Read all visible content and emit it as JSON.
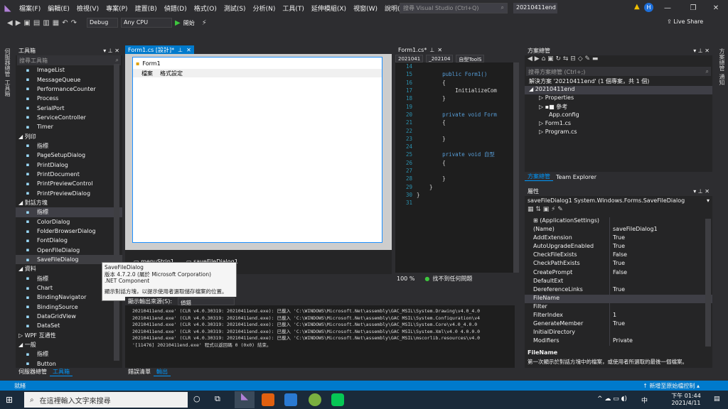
{
  "menu": {
    "items": [
      "檔案(F)",
      "編輯(E)",
      "檢視(V)",
      "專案(P)",
      "建置(B)",
      "偵錯(D)",
      "格式(O)",
      "測試(S)",
      "分析(N)",
      "工具(T)",
      "延伸模組(X)",
      "視窗(W)",
      "說明(H)"
    ],
    "search_placeholder": "搜尋 Visual Studio (Ctrl+Q)",
    "project_name": "20210411end",
    "avatar": "H"
  },
  "toolbar": {
    "config": "Debug",
    "platform": "Any CPU",
    "start": "開始",
    "live_share": "Live Share"
  },
  "side_tabs": [
    "伺服器總管",
    "工具箱"
  ],
  "right_side_tabs": [
    "方案總管",
    "通知"
  ],
  "toolbox": {
    "title": "工具箱",
    "search_placeholder": "搜尋工具箱",
    "items": [
      {
        "label": "ImageList",
        "type": "item"
      },
      {
        "label": "MessageQueue",
        "type": "item"
      },
      {
        "label": "PerformanceCounter",
        "type": "item"
      },
      {
        "label": "Process",
        "type": "item"
      },
      {
        "label": "SerialPort",
        "type": "item"
      },
      {
        "label": "ServiceController",
        "type": "item"
      },
      {
        "label": "Timer",
        "type": "item"
      },
      {
        "label": "◢ 列印",
        "type": "sec"
      },
      {
        "label": "指標",
        "type": "item"
      },
      {
        "label": "PageSetupDialog",
        "type": "item"
      },
      {
        "label": "PrintDialog",
        "type": "item"
      },
      {
        "label": "PrintDocument",
        "type": "item"
      },
      {
        "label": "PrintPreviewControl",
        "type": "item"
      },
      {
        "label": "PrintPreviewDialog",
        "type": "item"
      },
      {
        "label": "◢ 對話方塊",
        "type": "sec"
      },
      {
        "label": "指標",
        "type": "sel"
      },
      {
        "label": "ColorDialog",
        "type": "item"
      },
      {
        "label": "FolderBrowserDialog",
        "type": "item"
      },
      {
        "label": "FontDialog",
        "type": "item"
      },
      {
        "label": "OpenFileDialog",
        "type": "item"
      },
      {
        "label": "SaveFileDialog",
        "type": "hl"
      },
      {
        "label": "◢ 資料",
        "type": "sec"
      },
      {
        "label": "指標",
        "type": "item"
      },
      {
        "label": "Chart",
        "type": "item"
      },
      {
        "label": "BindingNavigator",
        "type": "item"
      },
      {
        "label": "BindingSource",
        "type": "item"
      },
      {
        "label": "DataGridView",
        "type": "item"
      },
      {
        "label": "DataSet",
        "type": "item"
      },
      {
        "label": "▷ WPF 互通性",
        "type": "sec"
      },
      {
        "label": "◢ 一般",
        "type": "sec"
      },
      {
        "label": "指標",
        "type": "item"
      },
      {
        "label": "Button",
        "type": "item"
      }
    ],
    "bottom_tabs": [
      "伺服器總管",
      "工具箱"
    ]
  },
  "tooltip": {
    "line1": "SaveFileDialog",
    "line2": "版本 4.7.2.0 (屬於 Microsoft Corporation)",
    "line3": ".NET Component",
    "line4": "顯示對話方塊，以提示使用者選取儲存檔案的位置。"
  },
  "designer": {
    "tab_label": "Form1.cs [設計]*",
    "form_title": "Form1",
    "menu_items": [
      "檔案",
      "格式設定"
    ],
    "tray_items": [
      "menuStrip1",
      "saveFileDialog1"
    ]
  },
  "code": {
    "tab_label": "Form1.cs*",
    "nav1": "2021041",
    "nav2": "_202104",
    "nav3": "自型ToolS",
    "lines": [
      {
        "n": "14",
        "t": ""
      },
      {
        "n": "15",
        "t": "        public Form1()"
      },
      {
        "n": "16",
        "t": "        {"
      },
      {
        "n": "17",
        "t": "            InitializeCom"
      },
      {
        "n": "18",
        "t": "        }"
      },
      {
        "n": "19",
        "t": ""
      },
      {
        "n": "20",
        "t": "        private void Form"
      },
      {
        "n": "21",
        "t": "        {"
      },
      {
        "n": "22",
        "t": ""
      },
      {
        "n": "23",
        "t": "        }"
      },
      {
        "n": "24",
        "t": ""
      },
      {
        "n": "25",
        "t": "        private void 自型"
      },
      {
        "n": "26",
        "t": "        {"
      },
      {
        "n": "27",
        "t": ""
      },
      {
        "n": "28",
        "t": "        }"
      },
      {
        "n": "29",
        "t": "    }"
      },
      {
        "n": "30",
        "t": "}"
      },
      {
        "n": "31",
        "t": ""
      }
    ],
    "zoom": "100 %",
    "issues": "找不到任何問題"
  },
  "output": {
    "source_label": "顯示輸出來源(S):",
    "source_value": "偵錯",
    "lines": [
      "20210411end.exe' (CLR v4.0.30319: 20210411end.exe): 已載入 'C:\\WINDOWS\\Microsoft.Net\\assembly\\GAC_MSIL\\System.Drawing\\v4.0_4.0",
      "20210411end.exe' (CLR v4.0.30319: 20210411end.exe): 已載入 'C:\\WINDOWS\\Microsoft.Net\\assembly\\GAC_MSIL\\System.Configuration\\v4",
      "20210411end.exe' (CLR v4.0.30319: 20210411end.exe): 已載入 'C:\\WINDOWS\\Microsoft.Net\\assembly\\GAC_MSIL\\System.Core\\v4.0_4.0.0",
      "20210411end.exe' (CLR v4.0.30319: 20210411end.exe): 已載入 'C:\\WINDOWS\\Microsoft.Net\\assembly\\GAC_MSIL\\System.Xml\\v4.0_4.0.0.0",
      "20210411end.exe' (CLR v4.0.30319: 20210411end.exe): 已載入 'C:\\WINDOWS\\Microsoft.Net\\assembly\\GAC_MSIL\\mscorlib.resources\\v4.0",
      "'[11476] 20210411end.exe' 程式以返回碼 0 (0x0) 結束。"
    ],
    "bottom_tabs": [
      "錯誤清單",
      "輸出"
    ]
  },
  "solution": {
    "title": "方案總管",
    "search_placeholder": "搜尋方案總管 (Ctrl+;)",
    "tree": [
      {
        "label": "解決方案 '20210411end' (1 個專案，共 1 個)",
        "indent": 0
      },
      {
        "label": "◢ 20210411end",
        "indent": 0
      },
      {
        "label": "▷ Properties",
        "indent": 1
      },
      {
        "label": "▷ ▪■ 參考",
        "indent": 1
      },
      {
        "label": "App.config",
        "indent": 2
      },
      {
        "label": "▷ Form1.cs",
        "indent": 1
      },
      {
        "label": "▷ Program.cs",
        "indent": 1
      }
    ],
    "tabs": [
      "方案總管",
      "Team Explorer"
    ]
  },
  "properties": {
    "title": "屬性",
    "object": "saveFileDialog1  System.Windows.Forms.SaveFileDialog",
    "rows": [
      {
        "n": "⊞ (ApplicationSettings)",
        "v": "",
        "sel": false
      },
      {
        "n": "(Name)",
        "v": "saveFileDialog1",
        "sel": false
      },
      {
        "n": "AddExtension",
        "v": "True",
        "sel": false
      },
      {
        "n": "AutoUpgradeEnabled",
        "v": "True",
        "sel": false
      },
      {
        "n": "CheckFileExists",
        "v": "False",
        "sel": false
      },
      {
        "n": "CheckPathExists",
        "v": "True",
        "sel": false
      },
      {
        "n": "CreatePrompt",
        "v": "False",
        "sel": false
      },
      {
        "n": "DefaultExt",
        "v": "",
        "sel": false
      },
      {
        "n": "DereferenceLinks",
        "v": "True",
        "sel": false
      },
      {
        "n": "FileName",
        "v": "",
        "sel": true
      },
      {
        "n": "Filter",
        "v": "",
        "sel": false
      },
      {
        "n": "FilterIndex",
        "v": "1",
        "sel": false
      },
      {
        "n": "GenerateMember",
        "v": "True",
        "sel": false
      },
      {
        "n": "InitialDirectory",
        "v": "",
        "sel": false
      },
      {
        "n": "Modifiers",
        "v": "Private",
        "sel": false
      }
    ],
    "desc_title": "FileName",
    "desc_text": "第一次顯示於對話方塊中的檔案，或使用者所選取的最後一個檔案。"
  },
  "status": {
    "left": "就緒",
    "right": "新增至原始檔控制"
  },
  "taskbar": {
    "search": "在這裡輸入文字來搜尋",
    "ime": "中",
    "time": "下午 01:44",
    "date": "2021/4/11"
  },
  "colors": {
    "accent": "#007acc",
    "editor_bg": "#1e1e1e",
    "panel_bg": "#252526"
  }
}
